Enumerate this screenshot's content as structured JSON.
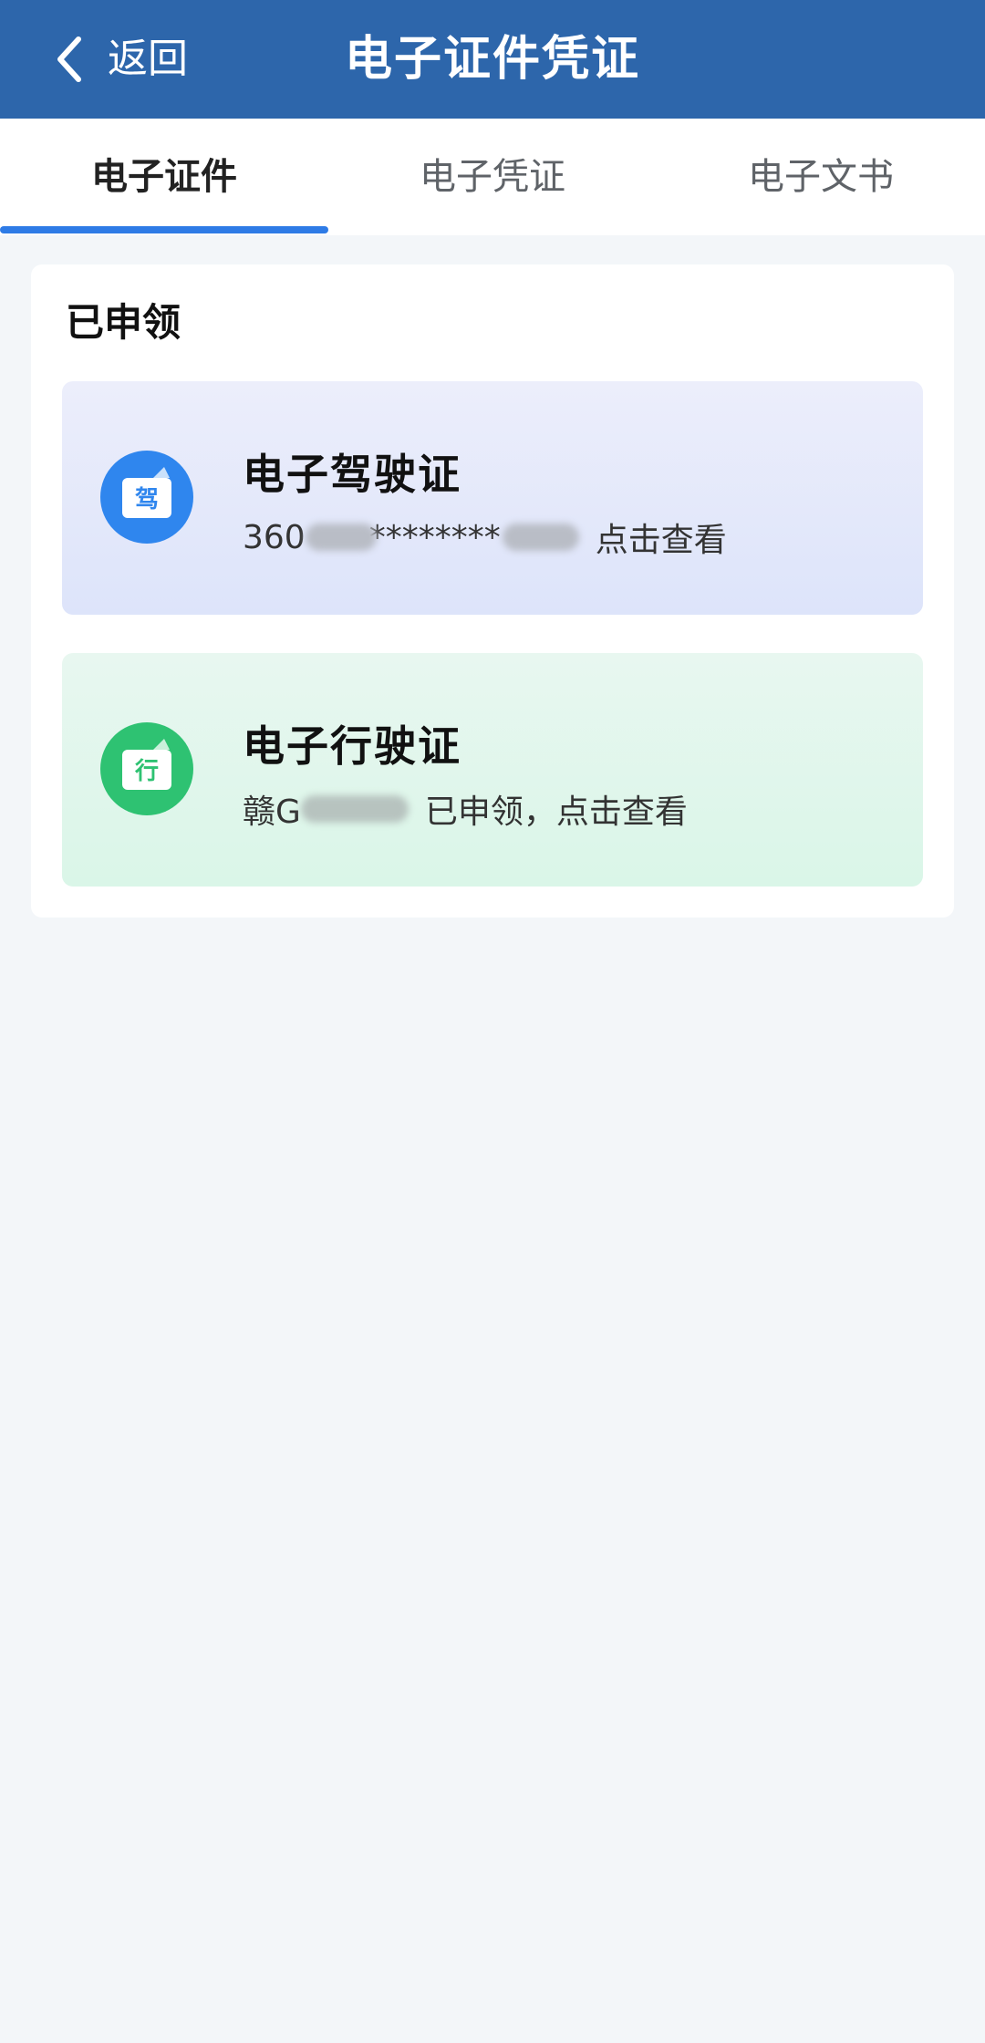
{
  "header": {
    "back_label": "返回",
    "title": "电子证件凭证",
    "background": "#2d66ab"
  },
  "tabs": [
    {
      "label": "电子证件",
      "active": true
    },
    {
      "label": "电子凭证",
      "active": false
    },
    {
      "label": "电子文书",
      "active": false
    }
  ],
  "accent_color": "#2e7be6",
  "section": {
    "title": "已申领",
    "cards": [
      {
        "name": "电子驾驶证",
        "badge_char": "驾",
        "id_prefix": "360",
        "id_mask": "********",
        "action": "点击查看",
        "icon": "driver-license-icon",
        "color": "#2f86ee"
      },
      {
        "name": "电子行驶证",
        "badge_char": "行",
        "id_prefix": "赣G",
        "action": "已申领，点击查看",
        "icon": "vehicle-license-icon",
        "color": "#2ec272"
      }
    ]
  }
}
